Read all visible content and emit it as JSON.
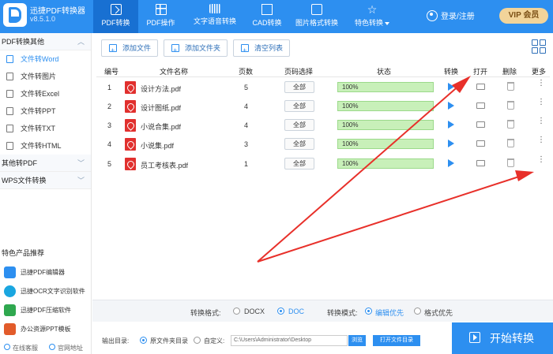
{
  "app": {
    "name": "迅捷PDF转换器",
    "version": "v8.5.1.0"
  },
  "nav": [
    {
      "label": "PDF转换"
    },
    {
      "label": "PDF操作"
    },
    {
      "label": "文字语音转换"
    },
    {
      "label": "CAD转换"
    },
    {
      "label": "图片格式转换"
    },
    {
      "label": "特色转换"
    }
  ],
  "header": {
    "login": "登录/注册",
    "vip": "VIP 会员"
  },
  "sidebar": {
    "section1": "PDF转换其他",
    "items": [
      "文件转Word",
      "文件转图片",
      "文件转Excel",
      "文件转PPT",
      "文件转TXT",
      "文件转HTML"
    ],
    "section2": "其他转PDF",
    "section3": "WPS文件转换",
    "rec_title": "特色产品推荐",
    "rec_items": [
      "迅捷PDF编辑器",
      "迅捷OCR文字识别软件",
      "迅捷PDF压缩软件",
      "办公资源PPT模板"
    ],
    "bottom": {
      "service": "在线客服",
      "site": "官网地址"
    }
  },
  "toolbar": {
    "add_file": "添加文件",
    "add_folder": "添加文件夹",
    "clear": "清空列表"
  },
  "table": {
    "headers": {
      "no": "编号",
      "name": "文件名称",
      "pages": "页数",
      "range": "页码选择",
      "status": "状态",
      "convert": "转换",
      "open": "打开",
      "delete": "删除",
      "more": "更多"
    },
    "rows": [
      {
        "no": "1",
        "name": "设计方法.pdf",
        "pages": "5",
        "range": "全部",
        "progress": "100%"
      },
      {
        "no": "2",
        "name": "设计图纸.pdf",
        "pages": "4",
        "range": "全部",
        "progress": "100%"
      },
      {
        "no": "3",
        "name": "小说合集.pdf",
        "pages": "4",
        "range": "全部",
        "progress": "100%"
      },
      {
        "no": "4",
        "name": "小说集.pdf",
        "pages": "3",
        "range": "全部",
        "progress": "100%"
      },
      {
        "no": "5",
        "name": "员工考核表.pdf",
        "pages": "1",
        "range": "全部",
        "progress": "100%"
      }
    ]
  },
  "format": {
    "label": "转换格式:",
    "docx": "DOCX",
    "doc": "DOC",
    "mode_label": "转换模式:",
    "edit_first": "编辑优先",
    "format_first": "格式优先"
  },
  "output": {
    "label": "输出目录:",
    "source": "原文件夹目录",
    "custom": "自定义:",
    "path": "C:\\Users\\Administrator\\Desktop",
    "browse": "浏览",
    "open_dir": "打开文件目录"
  },
  "start": "开始转换",
  "colors": {
    "primary": "#2d8ff0",
    "arrow": "#e8302a",
    "progress": "#c8f0b9"
  }
}
